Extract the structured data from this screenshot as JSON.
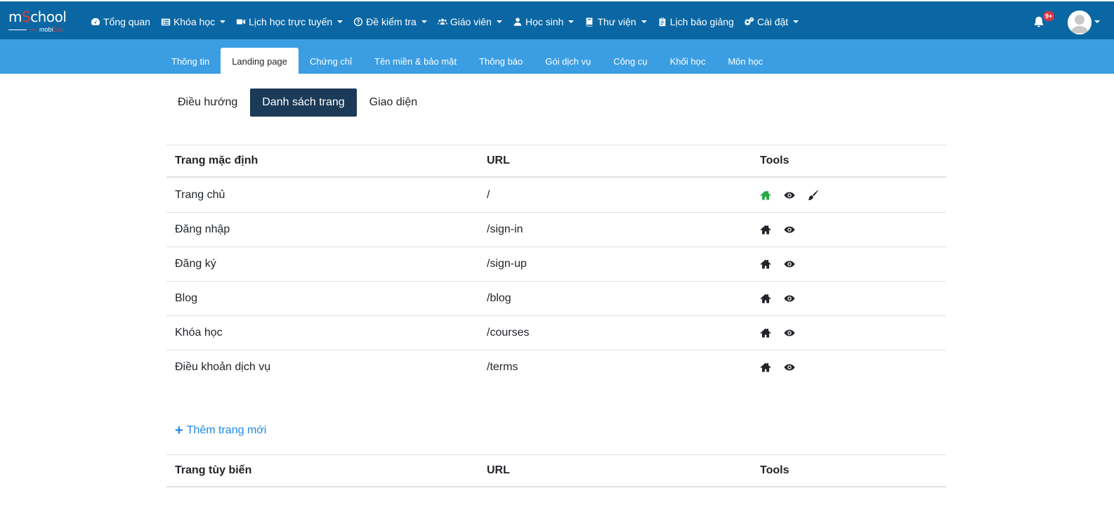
{
  "logo": {
    "brand_prefix": "m",
    "brand_accent": "S",
    "brand_suffix": "chool",
    "sub_prefix": "mobi",
    "sub_accent": "Edu"
  },
  "mainnav": [
    {
      "label": "Tổng quan",
      "icon": "dashboard-icon",
      "dropdown": false
    },
    {
      "label": "Khóa học",
      "icon": "list-icon",
      "dropdown": true
    },
    {
      "label": "Lịch học trực tuyến",
      "icon": "video-icon",
      "dropdown": true
    },
    {
      "label": "Đề kiểm tra",
      "icon": "question-circle-icon",
      "dropdown": true
    },
    {
      "label": "Giáo viên",
      "icon": "users-icon",
      "dropdown": true
    },
    {
      "label": "Học sinh",
      "icon": "user-icon",
      "dropdown": true
    },
    {
      "label": "Thư viện",
      "icon": "book-icon",
      "dropdown": true
    },
    {
      "label": "Lịch báo giảng",
      "icon": "clipboard-icon",
      "dropdown": false
    },
    {
      "label": "Cài đặt",
      "icon": "cogs-icon",
      "dropdown": true
    }
  ],
  "notifications": {
    "badge": "9+"
  },
  "subtabs": [
    "Thông tin",
    "Landing page",
    "Chứng chỉ",
    "Tên miền & bảo mật",
    "Thông báo",
    "Gói dịch vụ",
    "Công cụ",
    "Khối học",
    "Môn học"
  ],
  "subtabs_active": "Landing page",
  "pagetabs": [
    "Điều hướng",
    "Danh sách trang",
    "Giao diện"
  ],
  "pagetabs_active": "Danh sách trang",
  "default_table": {
    "headers": [
      "Trang mặc định",
      "URL",
      "Tools"
    ],
    "rows": [
      {
        "name": "Trang chủ",
        "url": "/",
        "home_active": true,
        "has_edit": true
      },
      {
        "name": "Đăng nhập",
        "url": "/sign-in",
        "home_active": false,
        "has_edit": false
      },
      {
        "name": "Đăng ký",
        "url": "/sign-up",
        "home_active": false,
        "has_edit": false
      },
      {
        "name": "Blog",
        "url": "/blog",
        "home_active": false,
        "has_edit": false
      },
      {
        "name": "Khóa học",
        "url": "/courses",
        "home_active": false,
        "has_edit": false
      },
      {
        "name": "Điều khoản dịch vụ",
        "url": "/terms",
        "home_active": false,
        "has_edit": false
      }
    ]
  },
  "add_page": {
    "plus": "+",
    "label": "Thêm trang mới"
  },
  "custom_table": {
    "headers": [
      "Trang tùy biến",
      "URL",
      "Tools"
    ]
  },
  "colors": {
    "topbar": "#0b67a3",
    "subbar": "#3b9ee3",
    "active_pagetab": "#1b3a57",
    "home_active": "#28a745",
    "link": "#1e88e5"
  }
}
